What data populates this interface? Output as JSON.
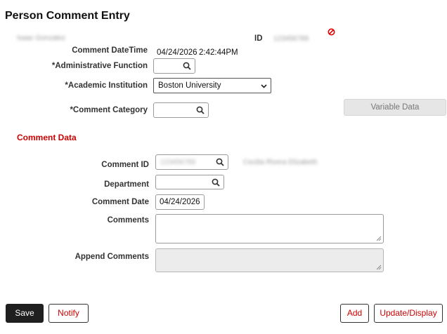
{
  "page": {
    "title": "Person Comment Entry"
  },
  "header": {
    "person_name": "Isaac Gonzalez",
    "id_label": "ID",
    "id_value": "123456789",
    "comment_datetime_label": "Comment DateTime",
    "comment_date": "04/24/2026",
    "comment_time": "2:42:44PM"
  },
  "form": {
    "admin_function_label": "*Administrative Function",
    "admin_function_value": "",
    "academic_institution_label": "*Academic Institution",
    "academic_institution_value": "Boston University",
    "comment_category_label": "*Comment Category",
    "comment_category_value": "",
    "variable_data_button": "Variable Data"
  },
  "comment_data": {
    "section_title": "Comment Data",
    "comment_id_label": "Comment ID",
    "comment_id_value": "123456789",
    "commenter_name": "Cecilia Rivera Elizabeth",
    "department_label": "Department",
    "department_value": "",
    "comment_date_label": "Comment Date",
    "comment_date_value": "04/24/2026",
    "comments_label": "Comments",
    "comments_value": "",
    "append_comments_label": "Append Comments",
    "append_comments_value": ""
  },
  "footer": {
    "save": "Save",
    "notify": "Notify",
    "add": "Add",
    "update_display": "Update/Display"
  },
  "colors": {
    "accent_red": "#cc0000",
    "primary_button": "#1f1f1f",
    "disabled_bg": "#ececec"
  }
}
